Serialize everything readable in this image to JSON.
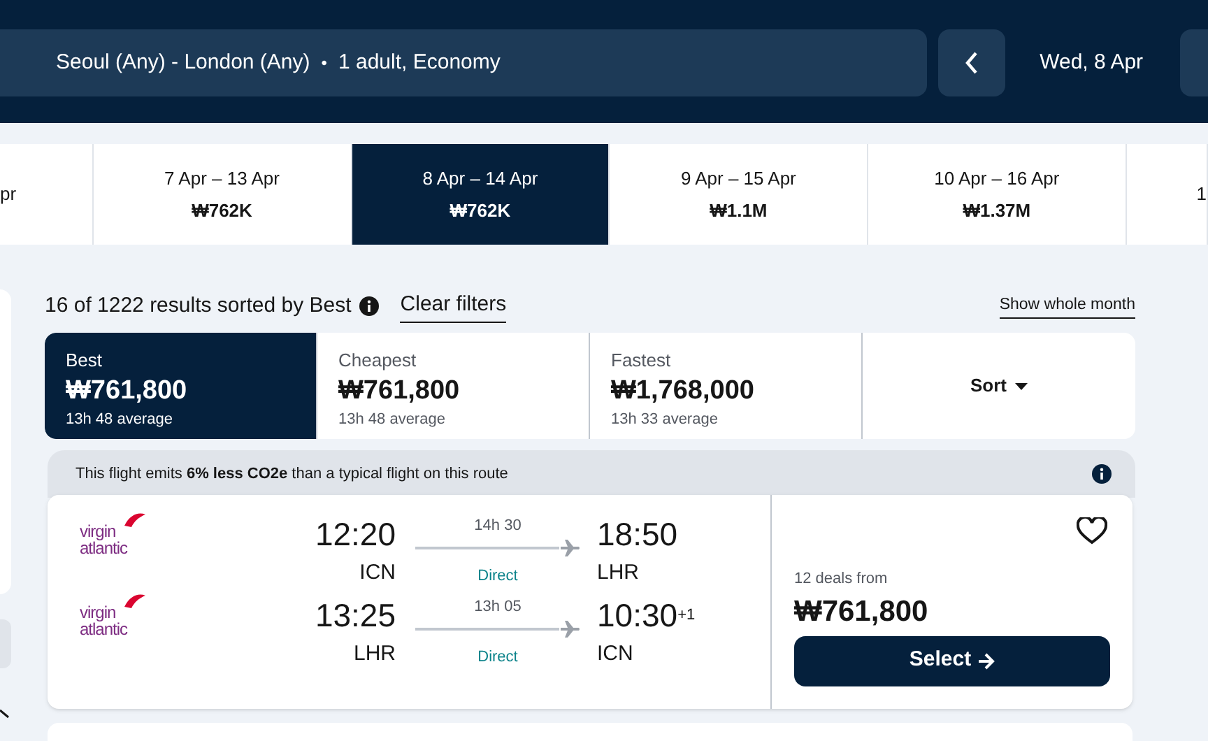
{
  "search": {
    "route": "Seoul (Any) - London (Any)",
    "separator": "•",
    "travellers": "1 adult, Economy",
    "date": "Wed, 8 Apr"
  },
  "date_tabs": [
    {
      "dates": "pr",
      "selected": false
    },
    {
      "dates": "7 Apr – 13 Apr",
      "price": "₩762K",
      "selected": false
    },
    {
      "dates": "8 Apr – 14 Apr",
      "price": "₩762K",
      "selected": true
    },
    {
      "dates": "9 Apr – 15 Apr",
      "price": "₩1.1M",
      "selected": false
    },
    {
      "dates": "10 Apr – 16 Apr",
      "price": "₩1.37M",
      "selected": false
    },
    {
      "dates": "1",
      "selected": false
    }
  ],
  "results_summary": "16 of 1222 results sorted by Best",
  "clear_filters": "Clear filters",
  "show_whole_month": "Show whole month",
  "sort_tabs": [
    {
      "label": "Best",
      "price": "₩761,800",
      "duration": "13h 48 average",
      "selected": true
    },
    {
      "label": "Cheapest",
      "price": "₩761,800",
      "duration": "13h 48 average",
      "selected": false
    },
    {
      "label": "Fastest",
      "price": "₩1,768,000",
      "duration": "13h 33 average",
      "selected": false
    }
  ],
  "sort_button": "Sort",
  "result": {
    "emissions_note": "This flight emits **6% less CO2e** than a typical flight on this route",
    "legs": [
      {
        "airline_logo": [
          "virgin",
          "atlantic"
        ],
        "depart_time": "12:20",
        "depart_airport": "ICN",
        "duration": "14h 30",
        "stops": "Direct",
        "arrive_time": "18:50",
        "arrive_airport": "LHR"
      },
      {
        "airline_logo": [
          "virgin",
          "atlantic"
        ],
        "depart_time": "13:25",
        "depart_airport": "LHR",
        "duration": "13h 05",
        "stops": "Direct",
        "arrive_time": "10:30$^{+1}$",
        "arrive_airport": "ICN"
      }
    ],
    "deals": "12 deals from",
    "price": "₩761,800",
    "select_button": "Select"
  }
}
